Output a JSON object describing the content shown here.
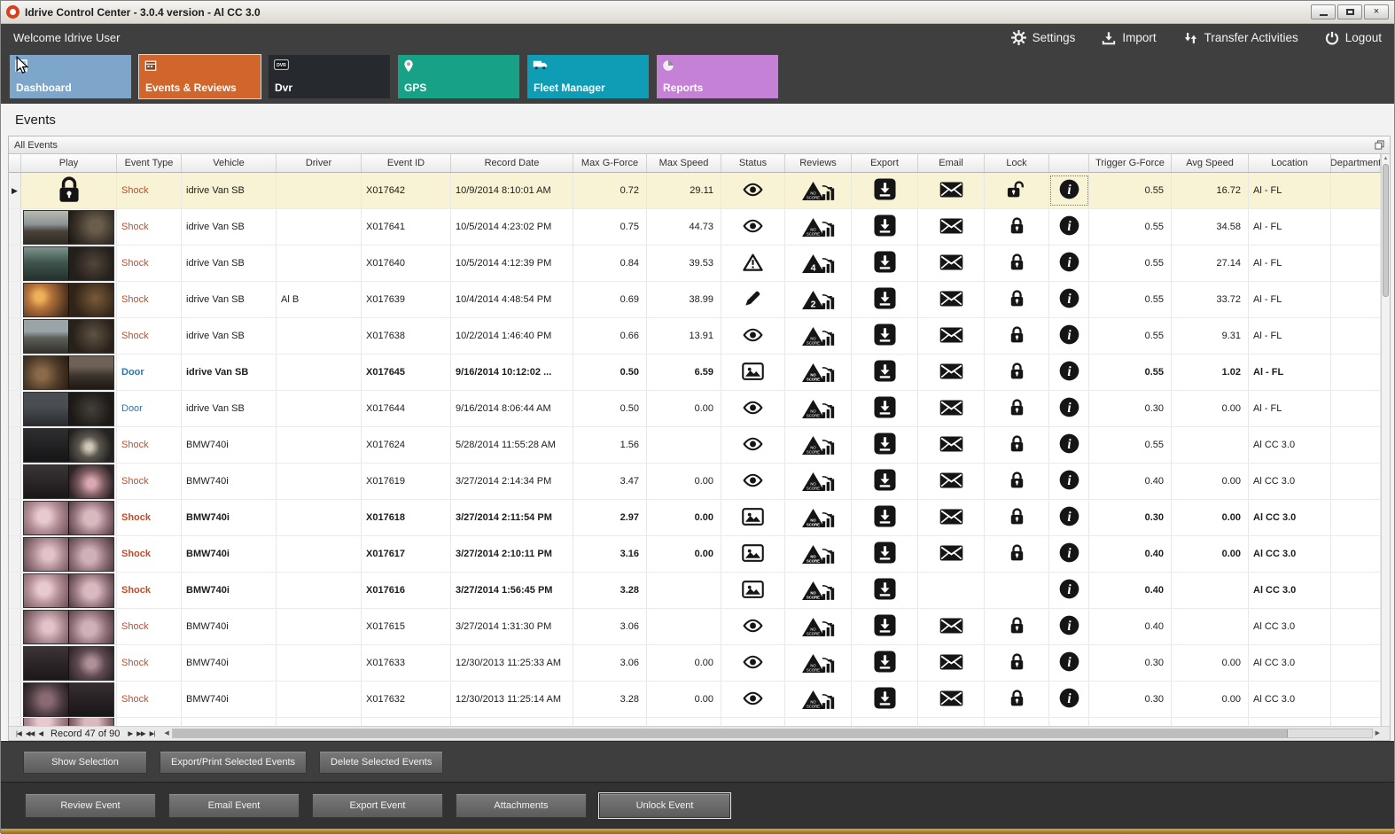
{
  "window": {
    "title": "Idrive Control Center - 3.0.4 version - Al CC 3.0",
    "controls": [
      "minimize",
      "maximize",
      "close"
    ]
  },
  "header": {
    "welcome": "Welcome Idrive User",
    "actions": [
      {
        "id": "settings",
        "label": "Settings",
        "icon": "gear-icon"
      },
      {
        "id": "import",
        "label": "Import",
        "icon": "import-icon"
      },
      {
        "id": "transfer",
        "label": "Transfer Activities",
        "icon": "transfer-arrows-icon"
      },
      {
        "id": "logout",
        "label": "Logout",
        "icon": "power-icon"
      }
    ]
  },
  "nav_tiles": [
    {
      "id": "dashboard",
      "label": "Dashboard",
      "color": "#7da6ca",
      "icon": "dashboard-icon",
      "active": false
    },
    {
      "id": "events",
      "label": "Events & Reviews",
      "color": "#d0662b",
      "icon": "events-reviews-icon",
      "active": true
    },
    {
      "id": "dvr",
      "label": "Dvr",
      "color": "#26292e",
      "icon": "dvr-icon",
      "active": false
    },
    {
      "id": "gps",
      "label": "GPS",
      "color": "#17a287",
      "icon": "gps-pin-icon",
      "active": false
    },
    {
      "id": "fleet",
      "label": "Fleet Manager",
      "color": "#0f9cb5",
      "icon": "fleet-manager-icon",
      "active": false
    },
    {
      "id": "reports",
      "label": "Reports",
      "color": "#c481d6",
      "icon": "reports-pie-icon",
      "active": false
    }
  ],
  "page": {
    "title": "Events"
  },
  "group_bar": {
    "label": "All Events"
  },
  "grid": {
    "columns": [
      "",
      "Play",
      "Event Type",
      "Vehicle",
      "Driver",
      "Event ID",
      "Record Date",
      "Max G-Force",
      "Max Speed",
      "Status",
      "Reviews",
      "Export",
      "Email",
      "Lock",
      "",
      "Trigger G-Force",
      "Avg Speed",
      "Location",
      "Department"
    ],
    "icons": {
      "play_locked": "locked-event-icon",
      "status_eye": "viewed-eye-icon",
      "status_warning": "warning-triangle-icon",
      "status_pencil": "edit-pencil-icon",
      "status_image": "snapshot-icon",
      "review": "review-score-icon",
      "export": "export-download-icon",
      "email": "email-envelope-icon",
      "lock_locked": "locked-icon",
      "lock_unlocked": "unlocked-icon",
      "info": "info-icon"
    },
    "rows": [
      {
        "selected": true,
        "play": "lock",
        "event_type": "Shock",
        "type_color": "shock",
        "vehicle": "idrive Van SB",
        "driver": "",
        "event_id": "X017642",
        "record_date": "10/9/2014 8:10:01 AM",
        "max_g": "0.72",
        "max_speed": "29.11",
        "status": "eye",
        "review": "NO SCORE",
        "lock_state": "unlocked",
        "trigger_g": "0.55",
        "avg_speed": "16.72",
        "location": "Al - FL"
      },
      {
        "play": "thumb",
        "thumb": "road-day",
        "event_type": "Shock",
        "type_color": "shock",
        "vehicle": "idrive Van SB",
        "driver": "",
        "event_id": "X017641",
        "record_date": "10/5/2014 4:23:02 PM",
        "max_g": "0.75",
        "max_speed": "44.73",
        "status": "eye",
        "review": "NO SCORE",
        "lock_state": "locked",
        "trigger_g": "0.55",
        "avg_speed": "34.58",
        "location": "Al - FL"
      },
      {
        "play": "thumb",
        "thumb": "road-teal",
        "event_type": "Shock",
        "type_color": "shock",
        "vehicle": "idrive Van SB",
        "driver": "",
        "event_id": "X017640",
        "record_date": "10/5/2014 4:12:39 PM",
        "max_g": "0.84",
        "max_speed": "39.53",
        "status": "warning",
        "review": "4",
        "lock_state": "locked",
        "trigger_g": "0.55",
        "avg_speed": "27.14",
        "location": "Al - FL"
      },
      {
        "play": "thumb",
        "thumb": "road-sunset",
        "event_type": "Shock",
        "type_color": "shock",
        "vehicle": "idrive Van SB",
        "driver": "Al B",
        "event_id": "X017639",
        "record_date": "10/4/2014 4:48:54 PM",
        "max_g": "0.69",
        "max_speed": "38.99",
        "status": "pencil",
        "review": "2",
        "lock_state": "locked",
        "trigger_g": "0.55",
        "avg_speed": "33.72",
        "location": "Al - FL"
      },
      {
        "play": "thumb",
        "thumb": "road-dusk",
        "event_type": "Shock",
        "type_color": "shock",
        "vehicle": "idrive Van SB",
        "driver": "",
        "event_id": "X017638",
        "record_date": "10/2/2014 1:46:40 PM",
        "max_g": "0.66",
        "max_speed": "13.91",
        "status": "eye",
        "review": "NO SCORE",
        "lock_state": "locked",
        "trigger_g": "0.55",
        "avg_speed": "9.31",
        "location": "Al - FL"
      },
      {
        "bold": true,
        "play": "thumb",
        "thumb": "cabin-warm",
        "event_type": "Door",
        "type_color": "door",
        "vehicle": "idrive Van SB",
        "driver": "",
        "event_id": "X017645",
        "record_date": "9/16/2014 10:12:02 ...",
        "max_g": "0.50",
        "max_speed": "6.59",
        "status": "image",
        "review": "NO SCORE",
        "lock_state": "locked",
        "trigger_g": "0.55",
        "avg_speed": "1.02",
        "location": "Al - FL"
      },
      {
        "play": "thumb",
        "thumb": "cabin-dark",
        "event_type": "Door",
        "type_color": "door",
        "vehicle": "idrive Van SB",
        "driver": "",
        "event_id": "X017644",
        "record_date": "9/16/2014 8:06:44 AM",
        "max_g": "0.50",
        "max_speed": "0.00",
        "status": "eye",
        "review": "NO SCORE",
        "lock_state": "locked",
        "trigger_g": "0.30",
        "avg_speed": "0.00",
        "location": "Al - FL"
      },
      {
        "play": "thumb",
        "thumb": "indoor-dark",
        "event_type": "Shock",
        "type_color": "shock",
        "vehicle": "BMW740i",
        "driver": "",
        "event_id": "X017624",
        "record_date": "5/28/2014 11:55:28 AM",
        "max_g": "1.56",
        "max_speed": "",
        "status": "eye",
        "review": "NO SCORE",
        "lock_state": "locked",
        "trigger_g": "0.55",
        "avg_speed": "",
        "location": "Al CC 3.0"
      },
      {
        "play": "thumb",
        "thumb": "indoor-pink",
        "event_type": "Shock",
        "type_color": "shock",
        "vehicle": "BMW740i",
        "driver": "",
        "event_id": "X017619",
        "record_date": "3/27/2014 2:14:34 PM",
        "max_g": "3.47",
        "max_speed": "0.00",
        "status": "eye",
        "review": "NO SCORE",
        "lock_state": "locked",
        "trigger_g": "0.40",
        "avg_speed": "0.00",
        "location": "Al CC 3.0"
      },
      {
        "bold": true,
        "play": "thumb",
        "thumb": "ir-a",
        "event_type": "Shock",
        "type_color": "shock",
        "vehicle": "BMW740i",
        "driver": "",
        "event_id": "X017618",
        "record_date": "3/27/2014 2:11:54 PM",
        "max_g": "2.97",
        "max_speed": "0.00",
        "status": "image",
        "review": "NO SCORE",
        "lock_state": "locked",
        "trigger_g": "0.30",
        "avg_speed": "0.00",
        "location": "Al CC 3.0"
      },
      {
        "bold": true,
        "play": "thumb",
        "thumb": "ir-b",
        "event_type": "Shock",
        "type_color": "shock",
        "vehicle": "BMW740i",
        "driver": "",
        "event_id": "X017617",
        "record_date": "3/27/2014 2:10:11 PM",
        "max_g": "3.16",
        "max_speed": "0.00",
        "status": "image",
        "review": "NO SCORE",
        "lock_state": "locked",
        "trigger_g": "0.40",
        "avg_speed": "0.00",
        "location": "Al CC 3.0"
      },
      {
        "bold": true,
        "play": "thumb",
        "thumb": "ir-a",
        "event_type": "Shock",
        "type_color": "shock",
        "vehicle": "BMW740i",
        "driver": "",
        "event_id": "X017616",
        "record_date": "3/27/2014 1:56:45 PM",
        "max_g": "3.28",
        "max_speed": "",
        "status": "image",
        "review": "NO SCORE",
        "has_email": false,
        "lock_state": "none",
        "trigger_g": "0.40",
        "avg_speed": "",
        "location": "Al CC 3.0"
      },
      {
        "play": "thumb",
        "thumb": "ir-b",
        "event_type": "Shock",
        "type_color": "shock",
        "vehicle": "BMW740i",
        "driver": "",
        "event_id": "X017615",
        "record_date": "3/27/2014 1:31:30 PM",
        "max_g": "3.06",
        "max_speed": "",
        "status": "eye",
        "review": "NO SCORE",
        "lock_state": "locked",
        "trigger_g": "0.40",
        "avg_speed": "",
        "location": "Al CC 3.0"
      },
      {
        "play": "thumb",
        "thumb": "ir-dark",
        "event_type": "Shock",
        "type_color": "shock",
        "vehicle": "BMW740i",
        "driver": "",
        "event_id": "X017633",
        "record_date": "12/30/2013 11:25:33 AM",
        "max_g": "3.06",
        "max_speed": "0.00",
        "status": "eye",
        "review": "NO SCORE",
        "lock_state": "locked",
        "trigger_g": "0.30",
        "avg_speed": "0.00",
        "location": "Al CC 3.0"
      },
      {
        "play": "thumb",
        "thumb": "ir-dark2",
        "event_type": "Shock",
        "type_color": "shock",
        "vehicle": "BMW740i",
        "driver": "",
        "event_id": "X017632",
        "record_date": "12/30/2013 11:25:14 AM",
        "max_g": "3.28",
        "max_speed": "0.00",
        "status": "eye",
        "review": "NO SCORE",
        "lock_state": "locked",
        "trigger_g": "0.30",
        "avg_speed": "0.00",
        "location": "Al CC 3.0"
      },
      {
        "partial": true,
        "play": "thumb",
        "thumb": "ir-a"
      }
    ]
  },
  "pager": {
    "record_text": "Record 47 of 90"
  },
  "selection_toolbar": {
    "buttons": [
      "Show Selection",
      "Export/Print Selected Events",
      "Delete Selected Events"
    ]
  },
  "event_toolbar": {
    "buttons": [
      "Review Event",
      "Email Event",
      "Export Event",
      "Attachments",
      "Unlock Event"
    ],
    "focused_index": 4
  }
}
